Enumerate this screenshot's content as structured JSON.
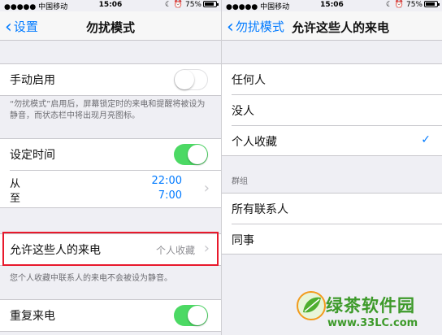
{
  "status_bar": {
    "carrier": "●●●●● 中国移动",
    "time": "15:06",
    "battery": "75%"
  },
  "left": {
    "back_label": "设置",
    "title": "勿扰模式",
    "manual_label": "手动启用",
    "manual_on": false,
    "manual_note": "“勿扰模式”启用后，屏幕锁定时的来电和提醒将被设为静音，而状态栏中将出现月亮图标。",
    "scheduled_label": "设定时间",
    "scheduled_on": true,
    "from_label": "从",
    "to_label": "至",
    "from_time": "22:00",
    "to_time": "7:00",
    "allow_calls_label": "允许这些人的来电",
    "allow_calls_value": "个人收藏",
    "allow_calls_note": "您个人收藏中联系人的来电不会被设为静音。",
    "repeat_label": "重复来电",
    "repeat_on": true
  },
  "right": {
    "back_label": "勿扰模式",
    "title": "允许这些人的来电",
    "options": [
      "任何人",
      "没人",
      "个人收藏"
    ],
    "selected": "个人收藏",
    "groups_header": "群组",
    "groups": [
      "所有联系人",
      "同事"
    ]
  },
  "watermark": {
    "title": "绿茶软件园",
    "url": "www.33LC.com"
  },
  "colors": {
    "accent": "#007aff",
    "toggle_on": "#4cd964",
    "highlight": "#e8192c",
    "watermark": "#3d9a2a"
  }
}
